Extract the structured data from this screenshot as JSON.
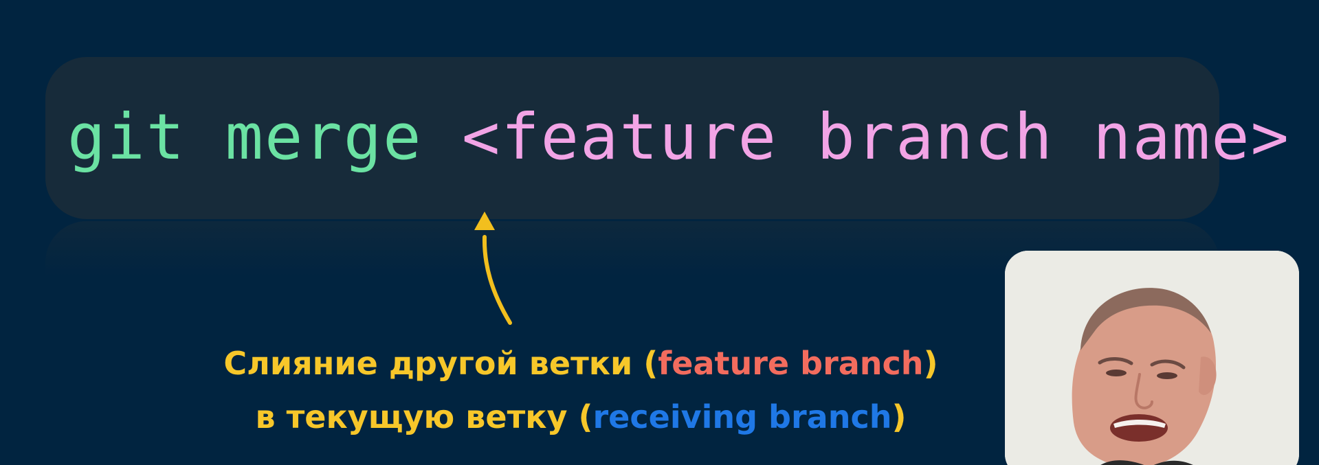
{
  "command": {
    "cmd": "git merge",
    "argument": "<feature branch name>"
  },
  "caption": {
    "line1_prefix": "Слияние другой ветки (",
    "line1_highlight": "feature branch",
    "line1_suffix": ")",
    "line2_prefix": "в текущую ветку (",
    "line2_highlight": "receiving branch",
    "line2_suffix": ")"
  },
  "colors": {
    "background": "#012440",
    "command_box": "#172b3a",
    "command": "#6be2a3",
    "argument": "#f2a4e6",
    "caption": "#f7c72a",
    "feature_branch": "#f36c5e",
    "receiving_branch": "#1f78e6",
    "arrow": "#f2bf1e"
  },
  "icons": {
    "arrow": "arrow-up-icon"
  }
}
